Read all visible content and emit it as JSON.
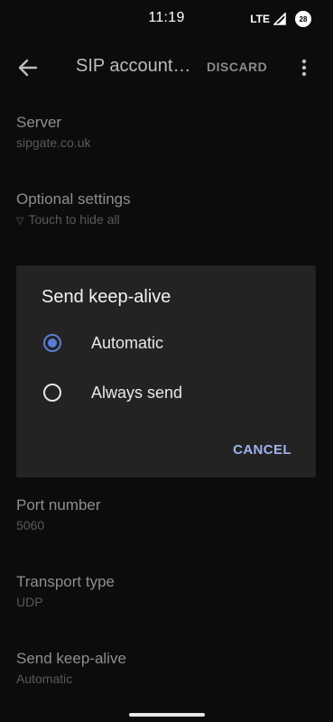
{
  "status_bar": {
    "time": "11:19",
    "network": "LTE",
    "battery_level": "28"
  },
  "app_bar": {
    "back_icon": "arrow-back-icon",
    "title": "SIP account…",
    "discard_label": "DISCARD",
    "more_icon": "more-vert-icon"
  },
  "settings": {
    "server": {
      "title": "Server",
      "summary": "sipgate.co.uk"
    },
    "optional": {
      "title": "Optional settings",
      "summary": "Touch to hide all",
      "summary_icon": "triangle-down-icon"
    },
    "port": {
      "title": "Port number",
      "summary": "5060"
    },
    "transport": {
      "title": "Transport type",
      "summary": "UDP"
    },
    "keepalive": {
      "title": "Send keep-alive",
      "summary": "Automatic"
    }
  },
  "dialog": {
    "title": "Send keep-alive",
    "options": [
      {
        "label": "Automatic",
        "selected": true
      },
      {
        "label": "Always send",
        "selected": false
      }
    ],
    "cancel_label": "CANCEL",
    "accent_color": "#5b7cd6"
  }
}
